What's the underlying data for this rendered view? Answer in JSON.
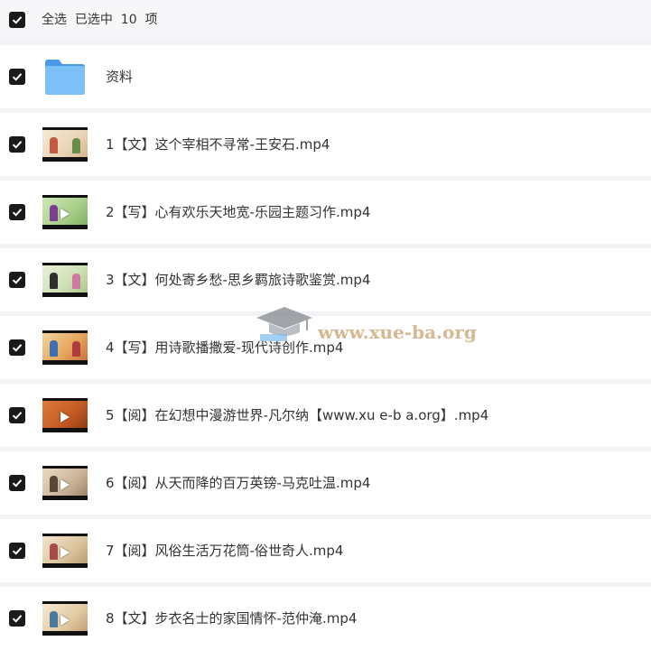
{
  "header": {
    "select_all_text": "全选  已选中  10  项",
    "checked": true
  },
  "items": [
    {
      "type": "folder",
      "name": "资料",
      "checked": true,
      "icon": "folder-icon"
    },
    {
      "type": "video",
      "name": "1【文】这个宰相不寻常-王安石.mp4",
      "checked": true,
      "icon": "video-thumbnail"
    },
    {
      "type": "video",
      "name": "2【写】心有欢乐天地宽-乐园主题习作.mp4",
      "checked": true,
      "icon": "video-thumbnail"
    },
    {
      "type": "video",
      "name": "3【文】何处寄乡愁-思乡羁旅诗歌鉴赏.mp4",
      "checked": true,
      "icon": "video-thumbnail"
    },
    {
      "type": "video",
      "name": "4【写】用诗歌播撒爱-现代诗创作.mp4",
      "checked": true,
      "icon": "video-thumbnail"
    },
    {
      "type": "video",
      "name": "5【阅】在幻想中漫游世界-凡尔纳【www.xu e-b a.org】.mp4",
      "checked": true,
      "icon": "video-thumbnail"
    },
    {
      "type": "video",
      "name": "6【阅】从天而降的百万英镑-马克吐温.mp4",
      "checked": true,
      "icon": "video-thumbnail"
    },
    {
      "type": "video",
      "name": "7【阅】风俗生活万花筒-俗世奇人.mp4",
      "checked": true,
      "icon": "video-thumbnail"
    },
    {
      "type": "video",
      "name": "8【文】步衣名士的家国情怀-范仲淹.mp4",
      "checked": true,
      "icon": "video-thumbnail"
    }
  ],
  "watermark": {
    "text": "www.xue-ba.org",
    "icon": "graduation-cap-logo"
  },
  "colors": {
    "checkbox": "#1a1a1a",
    "row_bg": "#ffffff",
    "page_bg": "#f3f3f5",
    "folder": "#5aaaf0"
  }
}
